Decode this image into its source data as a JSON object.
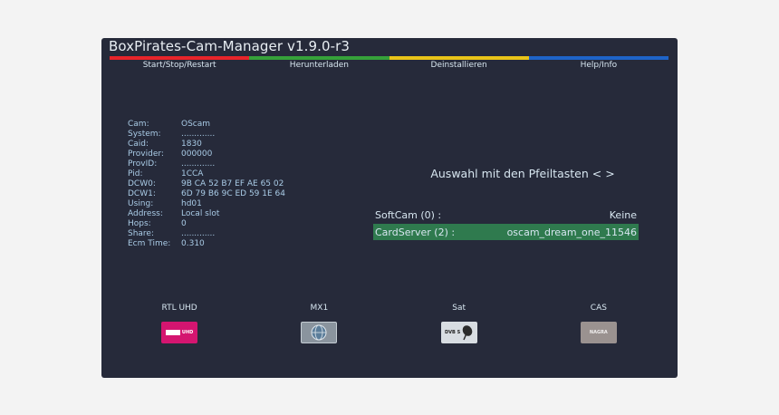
{
  "window": {
    "title": "BoxPirates-Cam-Manager v1.9.0-r3"
  },
  "color_keys": [
    {
      "label": "Start/Stop/Restart",
      "color": "#e8242a"
    },
    {
      "label": "Herunterladen",
      "color": "#36a23a"
    },
    {
      "label": "Deinstallieren",
      "color": "#e9c419"
    },
    {
      "label": "Help/Info",
      "color": "#1e64c8"
    }
  ],
  "ecm_info": [
    {
      "key": "Cam:",
      "value": "OScam"
    },
    {
      "key": "System:",
      "value": "............."
    },
    {
      "key": "Caid:",
      "value": "1830"
    },
    {
      "key": "Provider:",
      "value": "000000"
    },
    {
      "key": "ProvID:",
      "value": "............."
    },
    {
      "key": "Pid:",
      "value": "1CCA"
    },
    {
      "key": "DCW0:",
      "value": "9B CA 52 B7 EF AE 65 02"
    },
    {
      "key": "DCW1:",
      "value": "6D 79 B6 9C ED 59 1E 64"
    },
    {
      "key": "Using:",
      "value": "hd01"
    },
    {
      "key": "Address:",
      "value": "Local slot"
    },
    {
      "key": "Hops:",
      "value": "0"
    },
    {
      "key": "Share:",
      "value": "............."
    },
    {
      "key": "Ecm Time:",
      "value": "0.310"
    }
  ],
  "hint": "Auswahl mit den Pfeiltasten < >",
  "selections": {
    "softcam": {
      "label": "SoftCam (0) :",
      "value": "Keine"
    },
    "cardserver": {
      "label": "CardServer (2) :",
      "value": "oscam_dream_one_11546"
    }
  },
  "tiles": [
    {
      "label": "RTL UHD",
      "icon": "rtl-uhd-logo"
    },
    {
      "label": "MX1",
      "icon": "mx1-globe-logo"
    },
    {
      "label": "Sat",
      "icon": "dvb-s-dish-logo"
    },
    {
      "label": "CAS",
      "icon": "nagra-logo"
    }
  ],
  "rtl_logo_text": "UHD",
  "sat_logo_text": "DVB S",
  "cas_logo_text": "NAGRA"
}
